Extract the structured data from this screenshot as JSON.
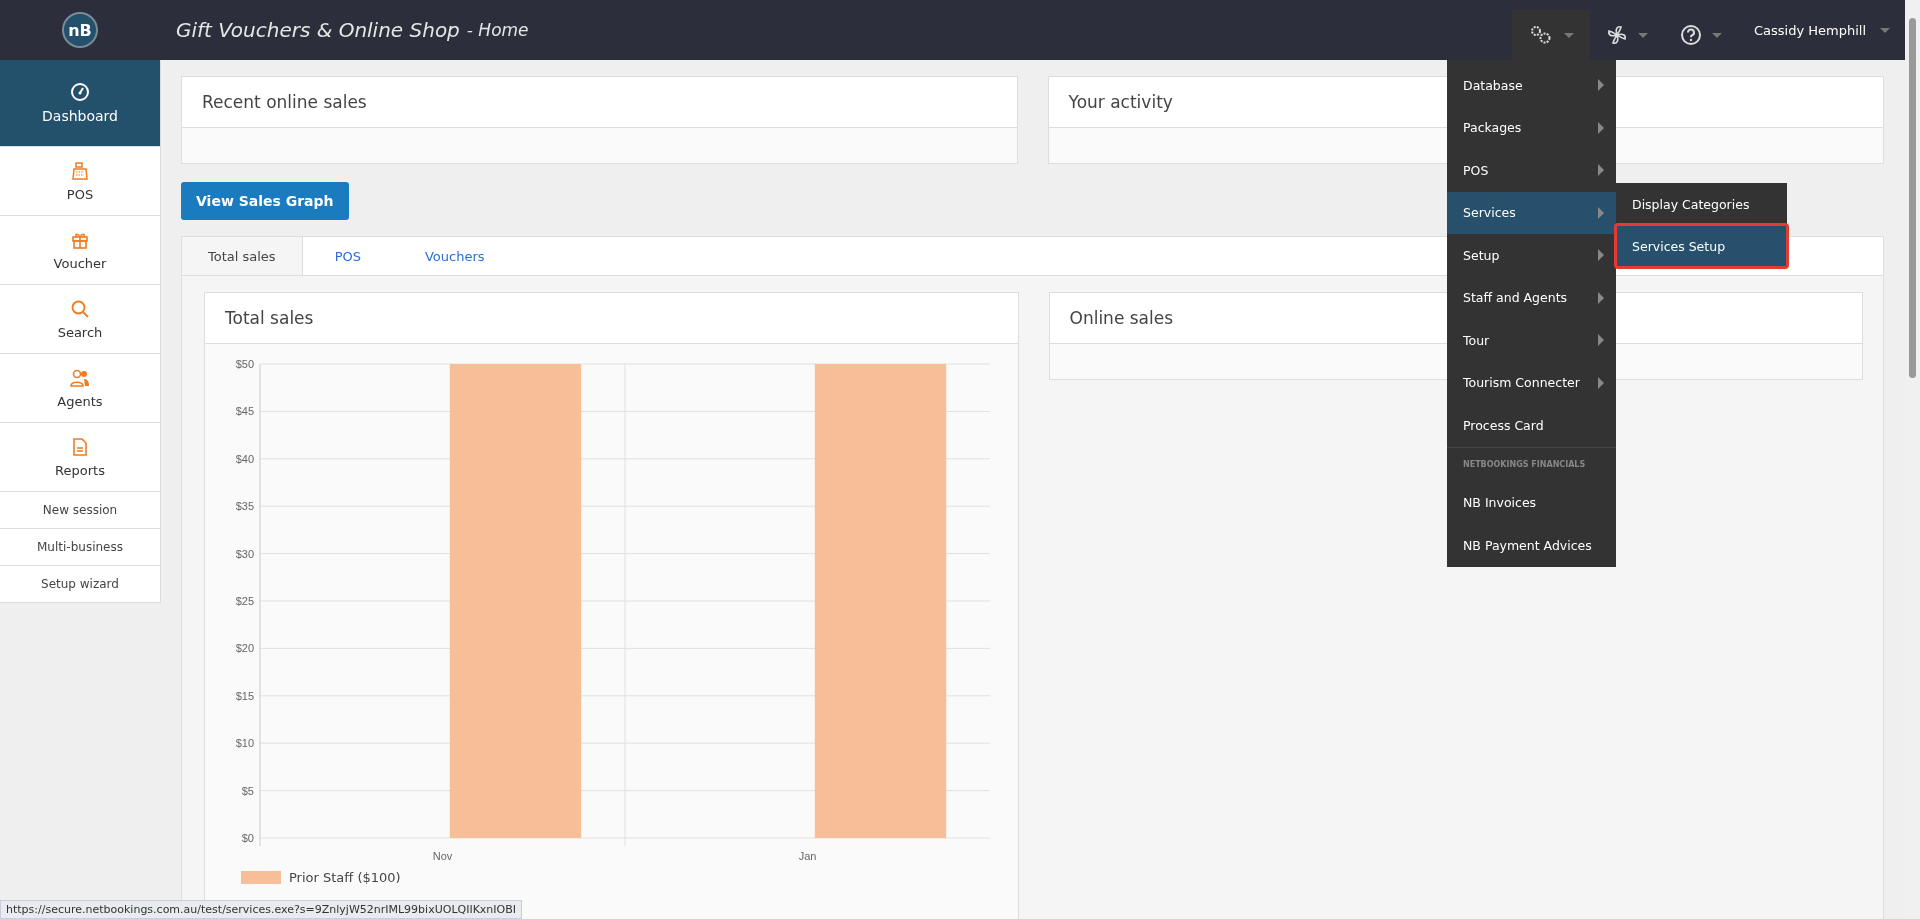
{
  "header": {
    "logo": "nB",
    "title": "Gift Vouchers & Online Shop",
    "subtitle": "- Home",
    "user": "Cassidy Hemphill"
  },
  "sidebar": {
    "items": [
      {
        "label": "Dashboard",
        "kind": "icon",
        "selected": true
      },
      {
        "label": "POS",
        "kind": "icon",
        "selected": false
      },
      {
        "label": "Voucher",
        "kind": "icon",
        "selected": false
      },
      {
        "label": "Search",
        "kind": "icon",
        "selected": false
      },
      {
        "label": "Agents",
        "kind": "icon",
        "selected": false
      },
      {
        "label": "Reports",
        "kind": "icon",
        "selected": false
      },
      {
        "label": "New session",
        "kind": "link",
        "selected": false
      },
      {
        "label": "Multi-business",
        "kind": "link",
        "selected": false
      },
      {
        "label": "Setup wizard",
        "kind": "link",
        "selected": false
      }
    ]
  },
  "panels": {
    "recent_online_sales": {
      "title": "Recent online sales"
    },
    "your_activity": {
      "title": "Your activity"
    }
  },
  "view_sales_graph_button": "View Sales Graph",
  "tabs": [
    {
      "label": "Total sales",
      "selected": true
    },
    {
      "label": "POS",
      "selected": false
    },
    {
      "label": "Vouchers",
      "selected": false
    }
  ],
  "total_sales": {
    "title": "Total sales",
    "chart_data": {
      "type": "bar",
      "grid": true,
      "categories": [
        "Nov",
        "Jan"
      ],
      "series": [
        {
          "name": "Prior Staff ($100)",
          "color": "#f7bf97",
          "values": [
            50,
            50
          ]
        }
      ],
      "ylim": [
        0,
        50
      ],
      "yticks": [
        {
          "value": 0,
          "label": "$0"
        },
        {
          "value": 5,
          "label": "$5"
        },
        {
          "value": 10,
          "label": "$10"
        },
        {
          "value": 15,
          "label": "$15"
        },
        {
          "value": 20,
          "label": "$20"
        },
        {
          "value": 25,
          "label": "$25"
        },
        {
          "value": 30,
          "label": "$30"
        },
        {
          "value": 35,
          "label": "$35"
        },
        {
          "value": 40,
          "label": "$40"
        },
        {
          "value": 45,
          "label": "$45"
        },
        {
          "value": 50,
          "label": "$50"
        }
      ]
    }
  },
  "online_sales": {
    "title": "Online sales"
  },
  "settings_menu": {
    "items": [
      {
        "label": "Database",
        "kind": "submenu",
        "selected": false
      },
      {
        "label": "Packages",
        "kind": "submenu",
        "selected": false
      },
      {
        "label": "POS",
        "kind": "submenu",
        "selected": false
      },
      {
        "label": "Services",
        "kind": "submenu",
        "selected": true
      },
      {
        "label": "Setup",
        "kind": "submenu",
        "selected": false
      },
      {
        "label": "Staff and Agents",
        "kind": "submenu",
        "selected": false
      },
      {
        "label": "Tour",
        "kind": "submenu",
        "selected": false
      },
      {
        "label": "Tourism Connecter",
        "kind": "submenu",
        "selected": false
      },
      {
        "label": "Process Card",
        "kind": "item",
        "selected": false
      },
      {
        "label": "NETBOOKINGS FINANCIALS",
        "kind": "header",
        "selected": false
      },
      {
        "label": "NB Invoices",
        "kind": "item",
        "selected": false
      },
      {
        "label": "NB Payment Advices",
        "kind": "item",
        "selected": false
      }
    ],
    "submenu": [
      {
        "label": "Display Categories",
        "selected": false,
        "outlined": false
      },
      {
        "label": "Services Setup",
        "selected": true,
        "outlined": true
      }
    ]
  },
  "status_url": "https://secure.netbookings.com.au/test/services.exe?s=9ZnlyjW52nrIML99bixUOLQIIKxnIOBI"
}
